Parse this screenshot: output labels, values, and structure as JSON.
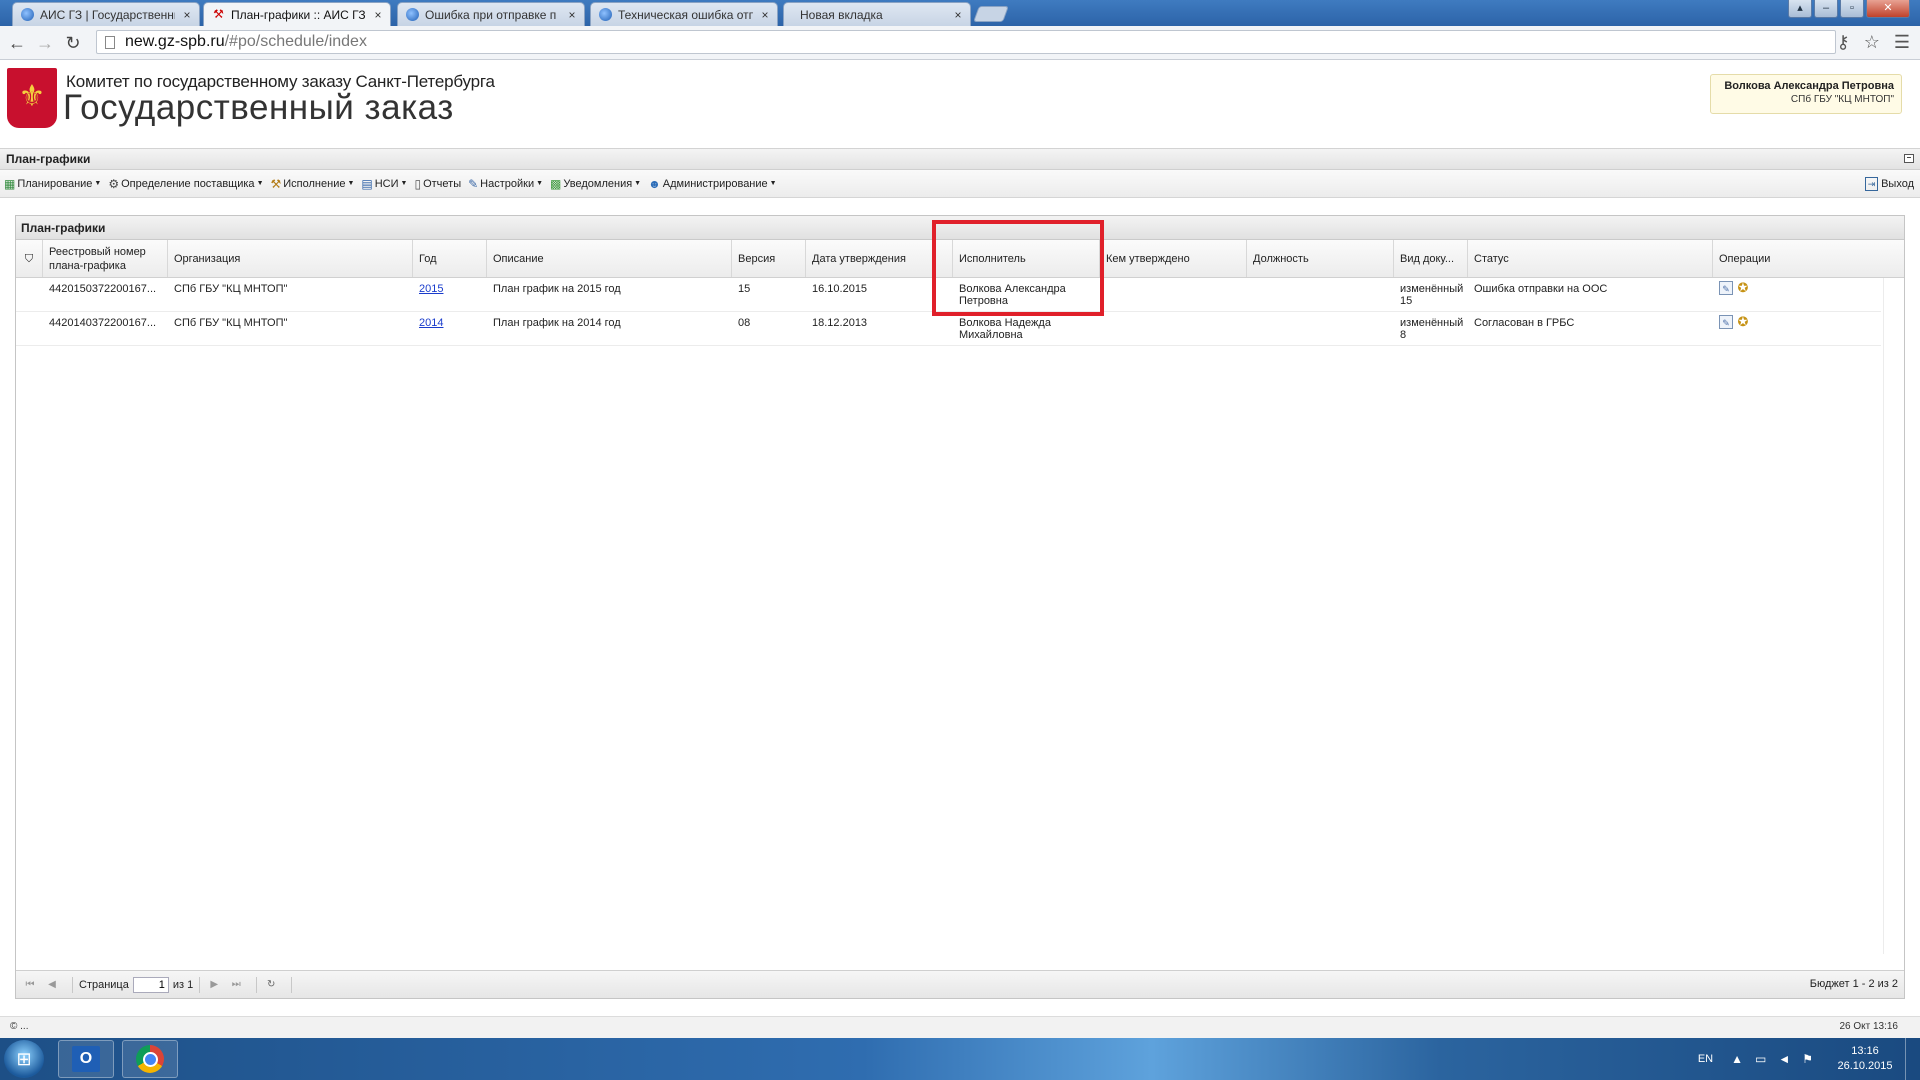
{
  "browser": {
    "tabs": [
      {
        "title": "АИС ГЗ | Государственны",
        "active": false,
        "icon": "ie-globe-icon"
      },
      {
        "title": "План-графики :: АИС ГЗ",
        "active": true,
        "icon": "tools-icon"
      },
      {
        "title": "Ошибка при отправке п",
        "active": false,
        "icon": "ie-globe-icon"
      },
      {
        "title": "Техническая ошибка отп",
        "active": false,
        "icon": "ie-globe-icon"
      },
      {
        "title": "Новая вкладка",
        "active": false,
        "icon": ""
      }
    ],
    "tab_close": "×",
    "url_host": "new.gz-spb.ru",
    "url_path": "/#po/schedule/index"
  },
  "header": {
    "subtitle": "Комитет по государственному заказу Санкт-Петербурга",
    "title": "Государственный заказ",
    "user_name": "Волкова Александра Петровна",
    "user_org": "СПб ГБУ \"КЦ МНТОП\""
  },
  "section": {
    "title": "План-графики"
  },
  "menu": {
    "items": [
      {
        "label": "Планирование",
        "icon": "planning-icon"
      },
      {
        "label": "Определение поставщика",
        "icon": "supplier-icon"
      },
      {
        "label": "Исполнение",
        "icon": "execution-icon"
      },
      {
        "label": "НСИ",
        "icon": "reference-book-icon"
      },
      {
        "label": "Отчеты",
        "icon": "report-icon"
      },
      {
        "label": "Настройки",
        "icon": "settings-icon"
      },
      {
        "label": "Уведомления",
        "icon": "notification-icon"
      },
      {
        "label": "Администрирование",
        "icon": "admin-user-icon"
      }
    ],
    "exit_label": "Выход"
  },
  "grid": {
    "title": "План-графики",
    "columns": [
      {
        "key": "reg_number",
        "label": "Реестровый номер плана-графика"
      },
      {
        "key": "org",
        "label": "Организация"
      },
      {
        "key": "year",
        "label": "Год"
      },
      {
        "key": "description",
        "label": "Описание"
      },
      {
        "key": "version",
        "label": "Версия"
      },
      {
        "key": "approval_date",
        "label": "Дата утверждения"
      },
      {
        "key": "executor",
        "label": "Исполнитель"
      },
      {
        "key": "approved_by",
        "label": "Кем утверждено"
      },
      {
        "key": "position",
        "label": "Должность"
      },
      {
        "key": "doc_type",
        "label": "Вид доку..."
      },
      {
        "key": "status",
        "label": "Статус"
      },
      {
        "key": "operations",
        "label": "Операции"
      }
    ],
    "rows": [
      {
        "reg_number": "4420150372200167...",
        "org": "СПб ГБУ \"КЦ МНТОП\"",
        "year": "2015",
        "description": "План график на 2015 год",
        "version": "15",
        "approval_date": "16.10.2015",
        "executor": "Волкова Александра Петровна",
        "approved_by": "",
        "position": "",
        "doc_type": "изменённый 15",
        "status": "Ошибка отправки на ООС"
      },
      {
        "reg_number": "4420140372200167...",
        "org": "СПб ГБУ \"КЦ МНТОП\"",
        "year": "2014",
        "description": "План график на 2014 год",
        "version": "08",
        "approval_date": "18.12.2013",
        "executor": "Волкова Надежда Михайловна",
        "approved_by": "",
        "position": "",
        "doc_type": "изменённый 8",
        "status": "Согласован в ГРБС"
      }
    ],
    "highlight_color": "#e0202a"
  },
  "paging": {
    "page_label": "Страница",
    "page_value": "1",
    "of_label": "из 1",
    "summary": "Бюджет 1 - 2 из 2"
  },
  "status_bar": {
    "left": "© ...",
    "right": "26 Окт 13:16"
  },
  "taskbar": {
    "lang": "EN",
    "time": "13:16",
    "date": "26.10.2015"
  }
}
